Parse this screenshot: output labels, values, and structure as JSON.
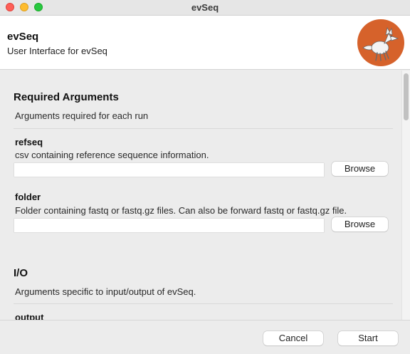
{
  "window": {
    "title": "evSeq"
  },
  "header": {
    "title": "evSeq",
    "subtitle": "User Interface for evSeq",
    "logo_icon": "fox-logo-icon",
    "logo_color": "#d6622b"
  },
  "sections": [
    {
      "title": "Required Arguments",
      "description": "Arguments required for each run",
      "args": [
        {
          "name": "refseq",
          "help": "csv containing reference sequence information.",
          "value": "",
          "button": "Browse"
        },
        {
          "name": "folder",
          "help": "Folder containing fastq or fastq.gz files. Can also be forward fastq or fastq.gz file.",
          "value": "",
          "button": "Browse"
        }
      ]
    },
    {
      "title": "I/O",
      "description": "Arguments specific to input/output of evSeq.",
      "args": [
        {
          "name": "output"
        }
      ]
    }
  ],
  "footer": {
    "cancel_label": "Cancel",
    "start_label": "Start"
  }
}
